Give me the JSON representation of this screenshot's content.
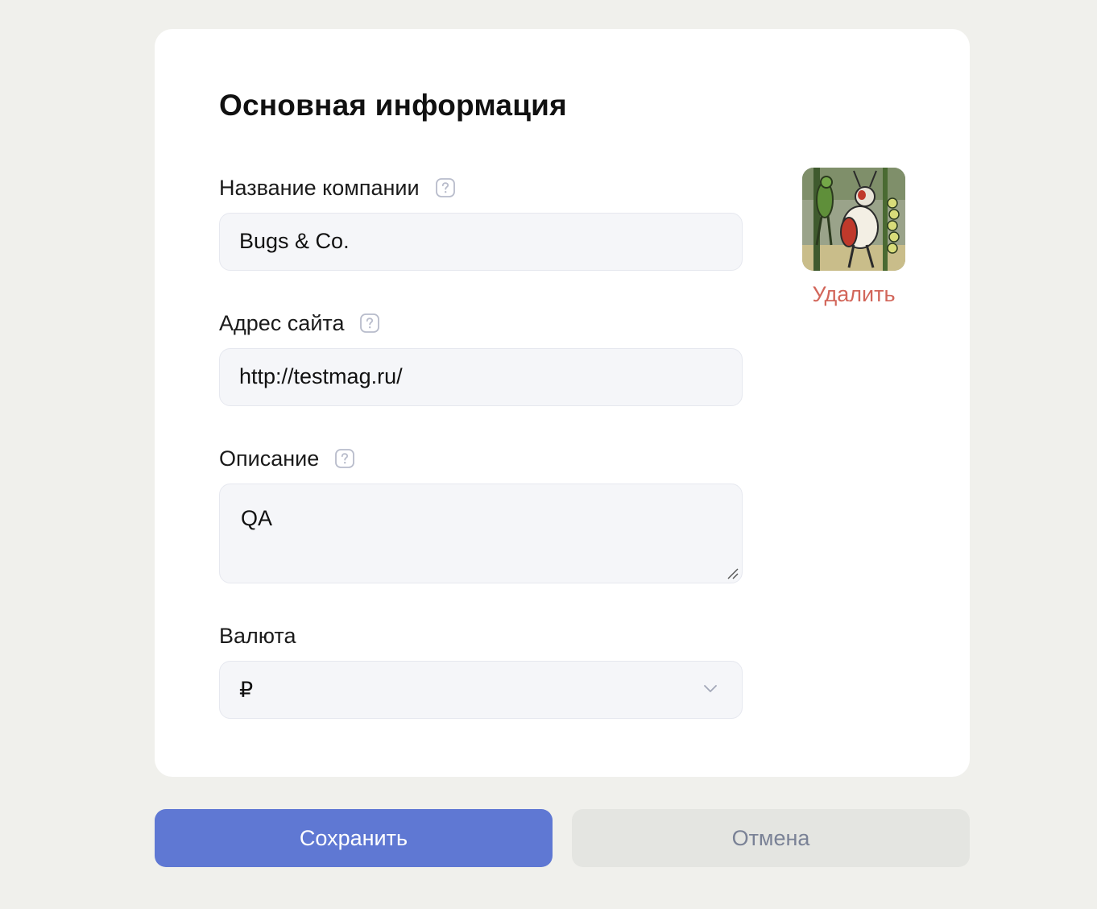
{
  "section": {
    "title": "Основная информация"
  },
  "fields": {
    "company_name": {
      "label": "Название компании",
      "value": "Bugs & Co."
    },
    "website": {
      "label": "Адрес сайта",
      "value": "http://testmag.ru/"
    },
    "description": {
      "label": "Описание",
      "value": "QA"
    },
    "currency": {
      "label": "Валюта",
      "value": "₽"
    }
  },
  "logo": {
    "delete_label": "Удалить"
  },
  "actions": {
    "save_label": "Сохранить",
    "cancel_label": "Отмена"
  },
  "colors": {
    "accent": "#5f78d3",
    "danger": "#d2665a",
    "background": "#f0f0ec",
    "input_bg": "#f5f6f9"
  }
}
